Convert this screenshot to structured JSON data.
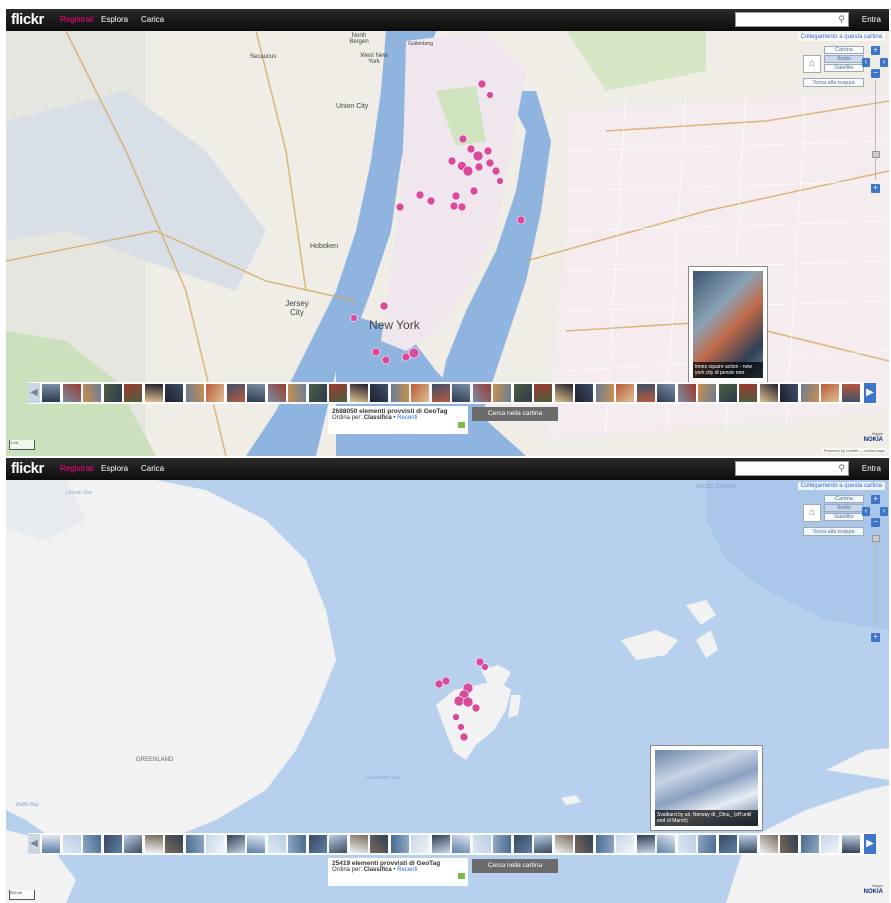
{
  "screenshots": [
    {
      "id": "nyc",
      "logo": "flickr",
      "nav": [
        "Registrati",
        "Esplora",
        "Carica"
      ],
      "signin": "Entra",
      "map_link": "Collegamento a questa cartina",
      "map_types": [
        "Cartina",
        "Ibrido",
        "Satellite"
      ],
      "map_type_selected": "Ibrido",
      "back_to_last": "Torna alla mappa",
      "popup_caption": "times square action - new york city di pensiv mor",
      "geotag_count": "2688050 elementi provvisti di GeoTag",
      "sort_prefix": "Ordina per:",
      "sort_options": [
        "Classifica",
        "Recenti"
      ],
      "search_map_button": "Cerca nella cartina",
      "scale_label": "1 mi",
      "nokia_logo": "NOKIA",
      "nokia_label": "Mappe",
      "attribution": "Powered by Leaflet — nokia-maps",
      "map_labels": [
        "New York",
        "Jersey City",
        "Union City",
        "Hoboken",
        "West New York",
        "North Bergen",
        "Secaucus",
        "Guttenberg"
      ]
    },
    {
      "id": "svalbard",
      "logo": "flickr",
      "nav": [
        "Registrati",
        "Esplora",
        "Carica"
      ],
      "signin": "Entra",
      "map_link": "Collegamento a questa cartina",
      "map_types": [
        "Cartina",
        "Ibrido",
        "Satellite"
      ],
      "map_type_selected": "Ibrido",
      "back_to_last": "Torna alla mappa",
      "popup_caption": "Svalbard by air, Norway di _Dinu_ (off until end of March)",
      "geotag_count": "25419 elementi provvisti di GeoTag",
      "sort_prefix": "Ordina per:",
      "sort_options": [
        "Classifica",
        "Recenti"
      ],
      "search_map_button": "Cerca nella cartina",
      "scale_label": "200 mi",
      "nokia_logo": "NOKIA",
      "nokia_label": "Mappe",
      "attribution": "Powered by Leaflet — nokia-maps",
      "map_labels": [
        "Arctic Ocean",
        "GREENLAND",
        "Lincoln Sea",
        "Baffin Bay",
        "Greenland Sea"
      ]
    }
  ],
  "colors": {
    "flickr_pink": "#ff0084",
    "link_blue": "#2a6ad9",
    "zoom_blue": "#3d75c9",
    "marker_pink": "#d94a9a",
    "water_nyc": "#8fb4e0",
    "water_arctic": "#b6d0ee"
  }
}
